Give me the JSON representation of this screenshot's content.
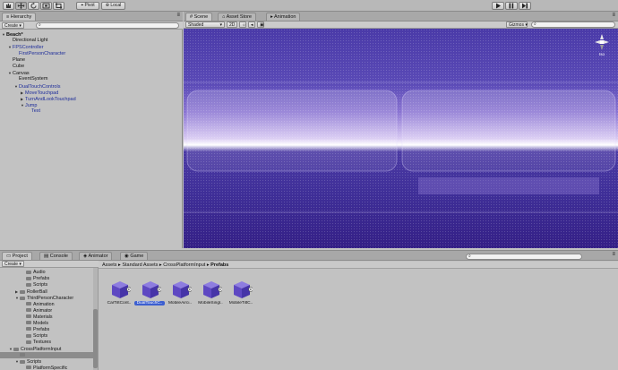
{
  "toolbar": {
    "tools": [
      "hand-tool",
      "move-tool",
      "rotate-tool",
      "scale-tool",
      "rect-tool"
    ],
    "pivot_label": "Pivot",
    "space_label": "Local"
  },
  "hierarchy": {
    "tab_label": "Hierarchy",
    "create_label": "Create",
    "rows": [
      {
        "label": "Beach*",
        "indent": 0,
        "bold": true,
        "arrow": "▼",
        "prefab": false
      },
      {
        "label": "Directional Light",
        "indent": 1,
        "arrow": "",
        "prefab": false
      },
      {
        "label": "FPSController",
        "indent": 1,
        "arrow": "▼",
        "prefab": true
      },
      {
        "label": "FirstPersonCharacter",
        "indent": 2,
        "arrow": "",
        "prefab": true
      },
      {
        "label": "Plane",
        "indent": 1,
        "arrow": "",
        "prefab": false
      },
      {
        "label": "Cube",
        "indent": 1,
        "arrow": "",
        "prefab": false
      },
      {
        "label": "Canvas",
        "indent": 1,
        "arrow": "▼",
        "prefab": false
      },
      {
        "label": "EventSystem",
        "indent": 2,
        "arrow": "",
        "prefab": false
      },
      {
        "label": "DualTouchControls",
        "indent": 2,
        "arrow": "▼",
        "prefab": true
      },
      {
        "label": "MoveTouchpad",
        "indent": 3,
        "arrow": "▶",
        "prefab": true
      },
      {
        "label": "TurnAndLookTouchpad",
        "indent": 3,
        "arrow": "▶",
        "prefab": true
      },
      {
        "label": "Jump",
        "indent": 3,
        "arrow": "▼",
        "prefab": true
      },
      {
        "label": "Text",
        "indent": 4,
        "arrow": "",
        "prefab": true
      }
    ]
  },
  "scene": {
    "tabs": [
      "Scene",
      "Asset Store",
      "Animation"
    ],
    "shading": "Shaded",
    "mode_2d": "2D",
    "gizmos_label": "Gizmos",
    "persp_label": "Iso"
  },
  "project": {
    "tabs": [
      "Project",
      "Console",
      "Animator",
      "Game"
    ],
    "create_label": "Create",
    "breadcrumb": [
      "Assets",
      "Standard Assets",
      "CrossPlatformInput",
      "Prefabs"
    ],
    "tree": [
      {
        "label": "Audio",
        "indent": 3
      },
      {
        "label": "Prefabs",
        "indent": 3
      },
      {
        "label": "Scripts",
        "indent": 3
      },
      {
        "label": "RollerBall",
        "indent": 2,
        "arrow": "▶"
      },
      {
        "label": "ThirdPersonCharacter",
        "indent": 2,
        "arrow": "▼"
      },
      {
        "label": "Animation",
        "indent": 3
      },
      {
        "label": "Animator",
        "indent": 3
      },
      {
        "label": "Materials",
        "indent": 3
      },
      {
        "label": "Models",
        "indent": 3
      },
      {
        "label": "Prefabs",
        "indent": 3
      },
      {
        "label": "Scripts",
        "indent": 3
      },
      {
        "label": "Textures",
        "indent": 3
      },
      {
        "label": "CrossPlatformInput",
        "indent": 1,
        "arrow": "▼"
      },
      {
        "label": "",
        "indent": 2,
        "selected": true
      },
      {
        "label": "Scripts",
        "indent": 2,
        "arrow": "▼"
      },
      {
        "label": "PlatformSpecific",
        "indent": 3
      }
    ],
    "assets": [
      {
        "label": "CarTiltCont..",
        "selected": false
      },
      {
        "label": "DualTouchC..",
        "selected": true
      },
      {
        "label": "MobileAirci..",
        "selected": false
      },
      {
        "label": "MobileSingl..",
        "selected": false
      },
      {
        "label": "MobileTiltC..",
        "selected": false
      }
    ]
  }
}
